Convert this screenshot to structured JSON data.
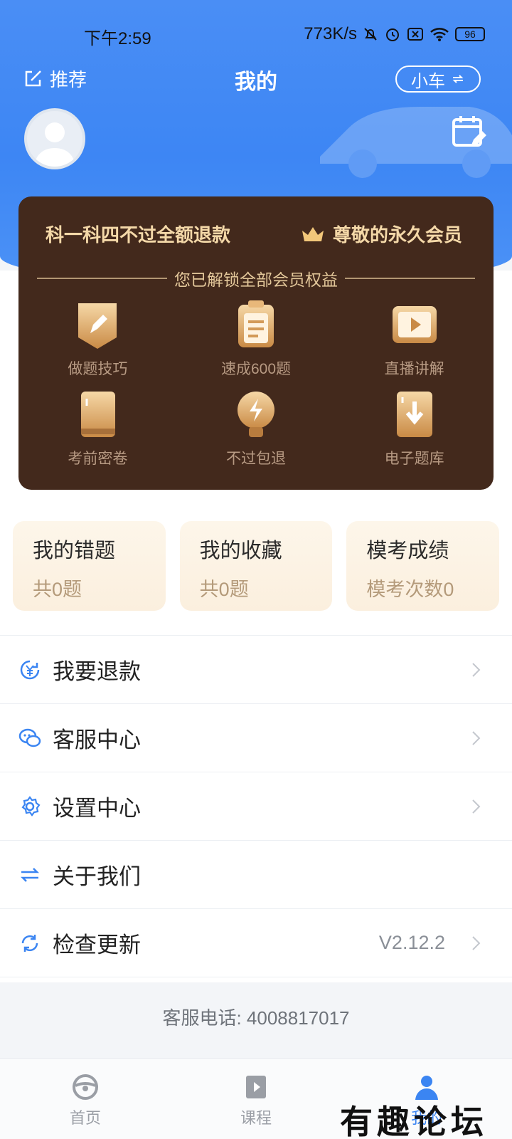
{
  "status_bar": {
    "time": "下午2:59",
    "net_speed": "773K/s",
    "battery": "96"
  },
  "header": {
    "recommend_label": "推荐",
    "title": "我的",
    "car_type": "小车"
  },
  "vip": {
    "left_text": "科一科四不过全额退款",
    "right_text": "尊敬的永久会员",
    "divider_text": "您已解锁全部会员权益",
    "benefits": [
      {
        "label": "做题技巧",
        "icon": "pencil-badge-icon"
      },
      {
        "label": "速成600题",
        "icon": "clipboard-icon"
      },
      {
        "label": "直播讲解",
        "icon": "play-icon"
      },
      {
        "label": "考前密卷",
        "icon": "book-icon"
      },
      {
        "label": "不过包退",
        "icon": "lightning-bulb-icon"
      },
      {
        "label": "电子题库",
        "icon": "download-book-icon"
      }
    ],
    "colors": {
      "card_bg": "#43291c",
      "gold": "#f4d8a8"
    }
  },
  "stat_cards": [
    {
      "title": "我的错题",
      "sub": "共0题"
    },
    {
      "title": "我的收藏",
      "sub": "共0题"
    },
    {
      "title": "模考成绩",
      "sub": "模考次数0"
    }
  ],
  "menu": [
    {
      "label": "我要退款",
      "icon": "refund-icon"
    },
    {
      "label": "客服中心",
      "icon": "chat-icon"
    },
    {
      "label": "设置中心",
      "icon": "gear-icon"
    },
    {
      "label": "关于我们",
      "icon": "swap-icon"
    },
    {
      "label": "检查更新",
      "icon": "refresh-icon",
      "value": "V2.12.2"
    }
  ],
  "hotline": "客服电话: 4008817017",
  "tabs": [
    {
      "label": "首页",
      "icon": "steering-wheel-icon"
    },
    {
      "label": "课程",
      "icon": "video-book-icon"
    },
    {
      "label": "我的",
      "icon": "person-icon",
      "active": true
    }
  ],
  "watermark": "有趣论坛",
  "theme": {
    "primary": "#3d86f4"
  }
}
